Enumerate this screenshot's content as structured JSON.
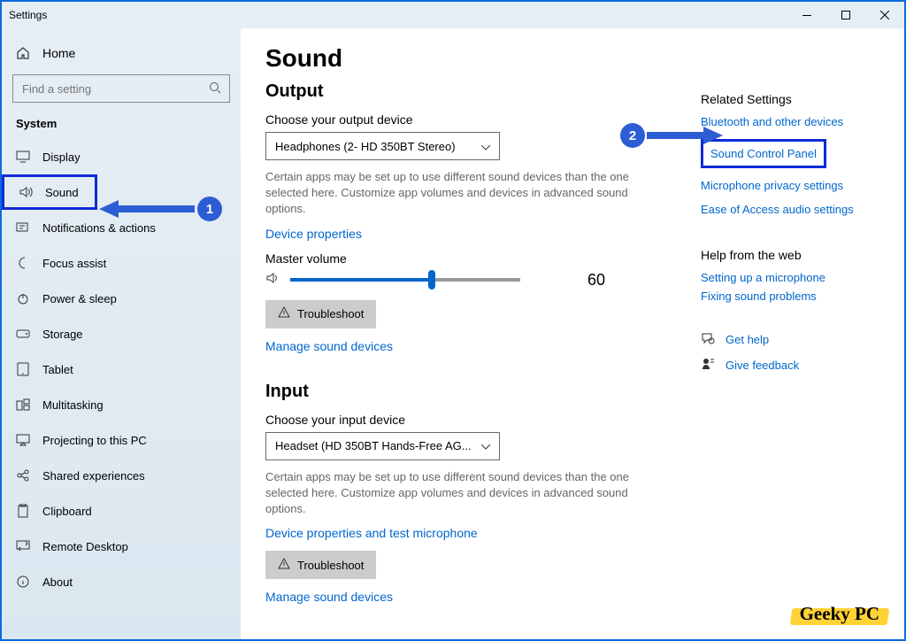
{
  "window": {
    "title": "Settings"
  },
  "sidebar": {
    "home": "Home",
    "search_placeholder": "Find a setting",
    "section": "System",
    "items": [
      {
        "label": "Display"
      },
      {
        "label": "Sound"
      },
      {
        "label": "Notifications & actions"
      },
      {
        "label": "Focus assist"
      },
      {
        "label": "Power & sleep"
      },
      {
        "label": "Storage"
      },
      {
        "label": "Tablet"
      },
      {
        "label": "Multitasking"
      },
      {
        "label": "Projecting to this PC"
      },
      {
        "label": "Shared experiences"
      },
      {
        "label": "Clipboard"
      },
      {
        "label": "Remote Desktop"
      },
      {
        "label": "About"
      }
    ]
  },
  "page": {
    "title": "Sound",
    "output": {
      "heading": "Output",
      "choose_label": "Choose your output device",
      "device": "Headphones (2- HD 350BT Stereo)",
      "desc": "Certain apps may be set up to use different sound devices than the one selected here. Customize app volumes and devices in advanced sound options.",
      "props_link": "Device properties",
      "volume_label": "Master volume",
      "volume_value": "60",
      "troubleshoot": "Troubleshoot",
      "manage": "Manage sound devices"
    },
    "input": {
      "heading": "Input",
      "choose_label": "Choose your input device",
      "device": "Headset (HD 350BT Hands-Free AG...",
      "desc": "Certain apps may be set up to use different sound devices than the one selected here. Customize app volumes and devices in advanced sound options.",
      "props_link": "Device properties and test microphone",
      "troubleshoot": "Troubleshoot",
      "manage": "Manage sound devices"
    }
  },
  "related": {
    "heading": "Related Settings",
    "links": [
      "Bluetooth and other devices",
      "Sound Control Panel",
      "Microphone privacy settings",
      "Ease of Access audio settings"
    ]
  },
  "help": {
    "heading": "Help from the web",
    "links": [
      "Setting up a microphone",
      "Fixing sound problems"
    ],
    "get_help": "Get help",
    "feedback": "Give feedback"
  },
  "annotations": {
    "badge1": "1",
    "badge2": "2"
  },
  "watermark": "Geeky PC"
}
